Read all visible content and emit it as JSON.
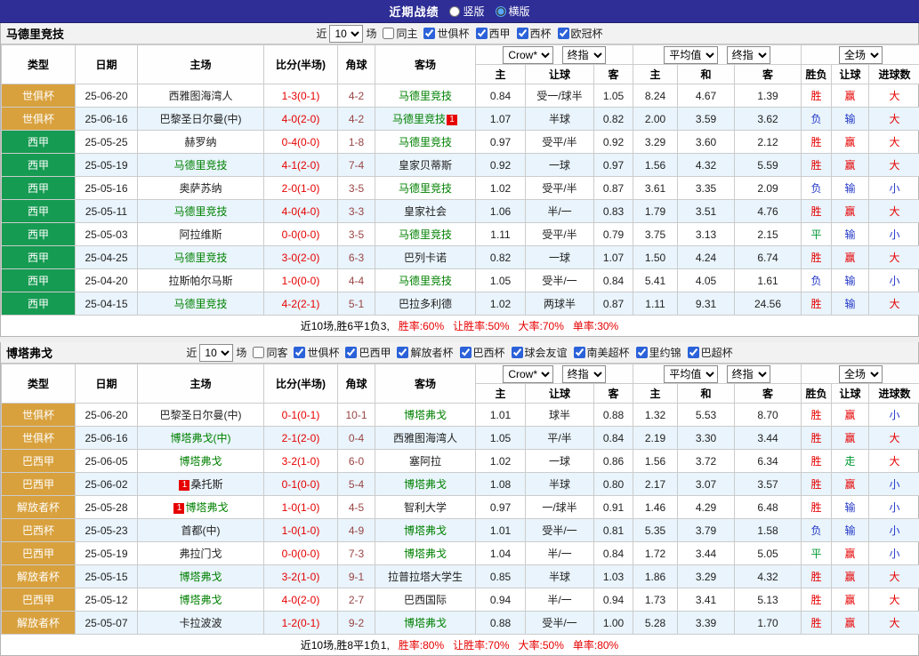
{
  "topbar": {
    "title": "近期战绩",
    "radios": [
      {
        "label": "竖版",
        "selected": false
      },
      {
        "label": "横版",
        "selected": true
      }
    ]
  },
  "colors": {
    "topbar_bg": "#2e2e96",
    "stripe": "#e9f4fc",
    "score": "#e60000",
    "corner": "#994444",
    "focus_team": "#008000",
    "type": {
      "orange": "#d8a13d",
      "green": "#169b52"
    },
    "verdict": {
      "胜": "#e60000",
      "平": "#009933",
      "负": "#2438c8",
      "赢": "#e60000",
      "走": "#009933",
      "输": "#2438c8",
      "大": "#e60000",
      "小": "#2438c8"
    }
  },
  "tables": [
    {
      "team": "马德里竞技",
      "filter": {
        "near_label": "近",
        "games_count": "10",
        "games_label": "场",
        "same_label": "同主",
        "same_checked": false,
        "leagues": [
          {
            "label": "世俱杯",
            "checked": true
          },
          {
            "label": "西甲",
            "checked": true
          },
          {
            "label": "西杯",
            "checked": true
          },
          {
            "label": "欧冠杯",
            "checked": true
          }
        ]
      },
      "header": {
        "cols": [
          "类型",
          "日期",
          "主场",
          "比分(半场)",
          "角球",
          "客场"
        ],
        "odds1_book": "Crow*",
        "odds1_time": "终指",
        "odds2_book": "平均值",
        "odds2_time": "终指",
        "scope": "全场",
        "sub": [
          "主",
          "让球",
          "客",
          "主",
          "和",
          "客",
          "胜负",
          "让球",
          "进球数"
        ]
      },
      "rows": [
        {
          "type": "世俱杯",
          "type_color": "orange",
          "date": "25-06-20",
          "home": {
            "text": "西雅图海湾人",
            "focus": false
          },
          "score": "1-3(0-1)",
          "corner": "4-2",
          "away": {
            "text": "马德里竞技",
            "focus": true
          },
          "odds": [
            "0.84",
            "受一/球半",
            "1.05",
            "8.24",
            "4.67",
            "1.39"
          ],
          "result": "胜",
          "handicap": "赢",
          "goals": "大"
        },
        {
          "type": "世俱杯",
          "type_color": "orange",
          "date": "25-06-16",
          "home": {
            "text": "巴黎圣日尔曼(中)",
            "focus": false
          },
          "score": "4-0(2-0)",
          "corner": "4-2",
          "away": {
            "text": "马德里竞技",
            "focus": true,
            "badge_after": "1"
          },
          "odds": [
            "1.07",
            "半球",
            "0.82",
            "2.00",
            "3.59",
            "3.62"
          ],
          "result": "负",
          "handicap": "输",
          "goals": "大"
        },
        {
          "type": "西甲",
          "type_color": "green",
          "date": "25-05-25",
          "home": {
            "text": "赫罗纳",
            "focus": false
          },
          "score": "0-4(0-0)",
          "corner": "1-8",
          "away": {
            "text": "马德里竞技",
            "focus": true
          },
          "odds": [
            "0.97",
            "受平/半",
            "0.92",
            "3.29",
            "3.60",
            "2.12"
          ],
          "result": "胜",
          "handicap": "赢",
          "goals": "大"
        },
        {
          "type": "西甲",
          "type_color": "green",
          "date": "25-05-19",
          "home": {
            "text": "马德里竞技",
            "focus": true
          },
          "score": "4-1(2-0)",
          "corner": "7-4",
          "away": {
            "text": "皇家贝蒂斯",
            "focus": false
          },
          "odds": [
            "0.92",
            "一球",
            "0.97",
            "1.56",
            "4.32",
            "5.59"
          ],
          "result": "胜",
          "handicap": "赢",
          "goals": "大"
        },
        {
          "type": "西甲",
          "type_color": "green",
          "date": "25-05-16",
          "home": {
            "text": "奥萨苏纳",
            "focus": false
          },
          "score": "2-0(1-0)",
          "corner": "3-5",
          "away": {
            "text": "马德里竞技",
            "focus": true
          },
          "odds": [
            "1.02",
            "受平/半",
            "0.87",
            "3.61",
            "3.35",
            "2.09"
          ],
          "result": "负",
          "handicap": "输",
          "goals": "小"
        },
        {
          "type": "西甲",
          "type_color": "green",
          "date": "25-05-11",
          "home": {
            "text": "马德里竞技",
            "focus": true
          },
          "score": "4-0(4-0)",
          "corner": "3-3",
          "away": {
            "text": "皇家社会",
            "focus": false
          },
          "odds": [
            "1.06",
            "半/一",
            "0.83",
            "1.79",
            "3.51",
            "4.76"
          ],
          "result": "胜",
          "handicap": "赢",
          "goals": "大"
        },
        {
          "type": "西甲",
          "type_color": "green",
          "date": "25-05-03",
          "home": {
            "text": "阿拉维斯",
            "focus": false
          },
          "score": "0-0(0-0)",
          "corner": "3-5",
          "away": {
            "text": "马德里竞技",
            "focus": true
          },
          "odds": [
            "1.11",
            "受平/半",
            "0.79",
            "3.75",
            "3.13",
            "2.15"
          ],
          "result": "平",
          "handicap": "输",
          "goals": "小"
        },
        {
          "type": "西甲",
          "type_color": "green",
          "date": "25-04-25",
          "home": {
            "text": "马德里竞技",
            "focus": true
          },
          "score": "3-0(2-0)",
          "corner": "6-3",
          "away": {
            "text": "巴列卡诺",
            "focus": false
          },
          "odds": [
            "0.82",
            "一球",
            "1.07",
            "1.50",
            "4.24",
            "6.74"
          ],
          "result": "胜",
          "handicap": "赢",
          "goals": "大"
        },
        {
          "type": "西甲",
          "type_color": "green",
          "date": "25-04-20",
          "home": {
            "text": "拉斯帕尔马斯",
            "focus": false
          },
          "score": "1-0(0-0)",
          "corner": "4-4",
          "away": {
            "text": "马德里竞技",
            "focus": true
          },
          "odds": [
            "1.05",
            "受半/一",
            "0.84",
            "5.41",
            "4.05",
            "1.61"
          ],
          "result": "负",
          "handicap": "输",
          "goals": "小"
        },
        {
          "type": "西甲",
          "type_color": "green",
          "date": "25-04-15",
          "home": {
            "text": "马德里竞技",
            "focus": true
          },
          "score": "4-2(2-1)",
          "corner": "5-1",
          "away": {
            "text": "巴拉多利德",
            "focus": false
          },
          "odds": [
            "1.02",
            "两球半",
            "0.87",
            "1.11",
            "9.31",
            "24.56"
          ],
          "result": "胜",
          "handicap": "输",
          "goals": "大"
        }
      ],
      "summary": {
        "prefix": "近10场,胜6平1负3,",
        "win_rate": "胜率:60%",
        "handicap_rate": "让胜率:50%",
        "big_rate": "大率:70%",
        "odd_rate": "单率:30%"
      }
    },
    {
      "team": "博塔弗戈",
      "filter": {
        "near_label": "近",
        "games_count": "10",
        "games_label": "场",
        "same_label": "同客",
        "same_checked": false,
        "leagues": [
          {
            "label": "世俱杯",
            "checked": true
          },
          {
            "label": "巴西甲",
            "checked": true
          },
          {
            "label": "解放者杯",
            "checked": true
          },
          {
            "label": "巴西杯",
            "checked": true
          },
          {
            "label": "球会友谊",
            "checked": true
          },
          {
            "label": "南美超杯",
            "checked": true
          },
          {
            "label": "里约锦",
            "checked": true
          },
          {
            "label": "巴超杯",
            "checked": true
          }
        ]
      },
      "header": {
        "cols": [
          "类型",
          "日期",
          "主场",
          "比分(半场)",
          "角球",
          "客场"
        ],
        "odds1_book": "Crow*",
        "odds1_time": "终指",
        "odds2_book": "平均值",
        "odds2_time": "终指",
        "scope": "全场",
        "sub": [
          "主",
          "让球",
          "客",
          "主",
          "和",
          "客",
          "胜负",
          "让球",
          "进球数"
        ]
      },
      "rows": [
        {
          "type": "世俱杯",
          "type_color": "orange",
          "date": "25-06-20",
          "home": {
            "text": "巴黎圣日尔曼(中)",
            "focus": false
          },
          "score": "0-1(0-1)",
          "corner": "10-1",
          "away": {
            "text": "博塔弗戈",
            "focus": true
          },
          "odds": [
            "1.01",
            "球半",
            "0.88",
            "1.32",
            "5.53",
            "8.70"
          ],
          "result": "胜",
          "handicap": "赢",
          "goals": "小"
        },
        {
          "type": "世俱杯",
          "type_color": "orange",
          "date": "25-06-16",
          "home": {
            "text": "博塔弗戈(中)",
            "focus": true
          },
          "score": "2-1(2-0)",
          "corner": "0-4",
          "away": {
            "text": "西雅图海湾人",
            "focus": false
          },
          "odds": [
            "1.05",
            "平/半",
            "0.84",
            "2.19",
            "3.30",
            "3.44"
          ],
          "result": "胜",
          "handicap": "赢",
          "goals": "大"
        },
        {
          "type": "巴西甲",
          "type_color": "orange",
          "date": "25-06-05",
          "home": {
            "text": "博塔弗戈",
            "focus": true
          },
          "score": "3-2(1-0)",
          "corner": "6-0",
          "away": {
            "text": "塞阿拉",
            "focus": false
          },
          "odds": [
            "1.02",
            "一球",
            "0.86",
            "1.56",
            "3.72",
            "6.34"
          ],
          "result": "胜",
          "handicap": "走",
          "goals": "大"
        },
        {
          "type": "巴西甲",
          "type_color": "orange",
          "date": "25-06-02",
          "home": {
            "text": "桑托斯",
            "focus": false,
            "badge_before": "1"
          },
          "score": "0-1(0-0)",
          "corner": "5-4",
          "away": {
            "text": "博塔弗戈",
            "focus": true
          },
          "odds": [
            "1.08",
            "半球",
            "0.80",
            "2.17",
            "3.07",
            "3.57"
          ],
          "result": "胜",
          "handicap": "赢",
          "goals": "小"
        },
        {
          "type": "解放者杯",
          "type_color": "orange",
          "date": "25-05-28",
          "home": {
            "text": "博塔弗戈",
            "focus": true,
            "badge_before": "1"
          },
          "score": "1-0(1-0)",
          "corner": "4-5",
          "away": {
            "text": "智利大学",
            "focus": false
          },
          "odds": [
            "0.97",
            "一/球半",
            "0.91",
            "1.46",
            "4.29",
            "6.48"
          ],
          "result": "胜",
          "handicap": "输",
          "goals": "小"
        },
        {
          "type": "巴西杯",
          "type_color": "orange",
          "date": "25-05-23",
          "home": {
            "text": "首都(中)",
            "focus": false
          },
          "score": "1-0(1-0)",
          "corner": "4-9",
          "away": {
            "text": "博塔弗戈",
            "focus": true
          },
          "odds": [
            "1.01",
            "受半/一",
            "0.81",
            "5.35",
            "3.79",
            "1.58"
          ],
          "result": "负",
          "handicap": "输",
          "goals": "小"
        },
        {
          "type": "巴西甲",
          "type_color": "orange",
          "date": "25-05-19",
          "home": {
            "text": "弗拉门戈",
            "focus": false
          },
          "score": "0-0(0-0)",
          "corner": "7-3",
          "away": {
            "text": "博塔弗戈",
            "focus": true
          },
          "odds": [
            "1.04",
            "半/一",
            "0.84",
            "1.72",
            "3.44",
            "5.05"
          ],
          "result": "平",
          "handicap": "赢",
          "goals": "小"
        },
        {
          "type": "解放者杯",
          "type_color": "orange",
          "date": "25-05-15",
          "home": {
            "text": "博塔弗戈",
            "focus": true
          },
          "score": "3-2(1-0)",
          "corner": "9-1",
          "away": {
            "text": "拉普拉塔大学生",
            "focus": false
          },
          "odds": [
            "0.85",
            "半球",
            "1.03",
            "1.86",
            "3.29",
            "4.32"
          ],
          "result": "胜",
          "handicap": "赢",
          "goals": "大"
        },
        {
          "type": "巴西甲",
          "type_color": "orange",
          "date": "25-05-12",
          "home": {
            "text": "博塔弗戈",
            "focus": true
          },
          "score": "4-0(2-0)",
          "corner": "2-7",
          "away": {
            "text": "巴西国际",
            "focus": false
          },
          "odds": [
            "0.94",
            "半/一",
            "0.94",
            "1.73",
            "3.41",
            "5.13"
          ],
          "result": "胜",
          "handicap": "赢",
          "goals": "大"
        },
        {
          "type": "解放者杯",
          "type_color": "orange",
          "date": "25-05-07",
          "home": {
            "text": "卡拉波波",
            "focus": false
          },
          "score": "1-2(0-1)",
          "corner": "9-2",
          "away": {
            "text": "博塔弗戈",
            "focus": true
          },
          "odds": [
            "0.88",
            "受半/一",
            "1.00",
            "5.28",
            "3.39",
            "1.70"
          ],
          "result": "胜",
          "handicap": "赢",
          "goals": "大"
        }
      ],
      "summary": {
        "prefix": "近10场,胜8平1负1,",
        "win_rate": "胜率:80%",
        "handicap_rate": "让胜率:70%",
        "big_rate": "大率:50%",
        "odd_rate": "单率:80%"
      }
    }
  ]
}
